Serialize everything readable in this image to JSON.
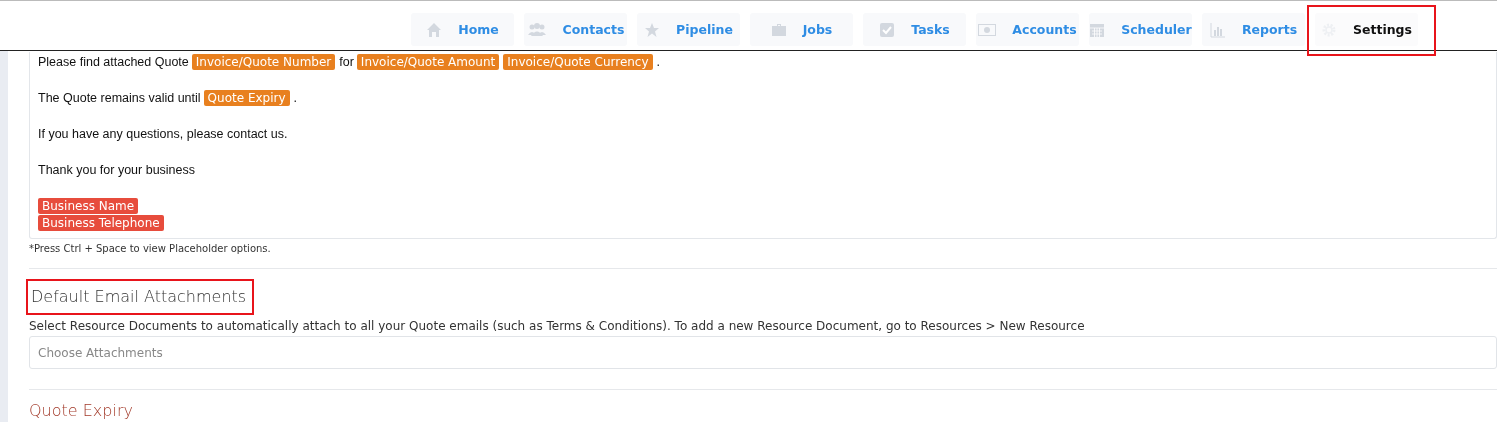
{
  "nav": {
    "tabs": [
      {
        "label": "Home",
        "selected": false,
        "highlighted": false
      },
      {
        "label": "Contacts",
        "selected": false,
        "highlighted": false
      },
      {
        "label": "Pipeline",
        "selected": false,
        "highlighted": false
      },
      {
        "label": "Jobs",
        "selected": false,
        "highlighted": false
      },
      {
        "label": "Tasks",
        "selected": false,
        "highlighted": false
      },
      {
        "label": "Accounts",
        "selected": false,
        "highlighted": false
      },
      {
        "label": "Scheduler",
        "selected": false,
        "highlighted": false
      },
      {
        "label": "Reports",
        "selected": false,
        "highlighted": false
      },
      {
        "label": "Settings",
        "selected": true,
        "highlighted": true
      }
    ]
  },
  "editor": {
    "paragraphs": [
      {
        "parts": [
          {
            "kind": "text",
            "text": "Please find attached Quote"
          },
          {
            "kind": "tag",
            "text": "Invoice/Quote Number",
            "color": "#e8801f"
          },
          {
            "kind": "text",
            "text": "for"
          },
          {
            "kind": "tag",
            "text": "Invoice/Quote Amount",
            "color": "#e8801f"
          },
          {
            "kind": "tag",
            "text": "Invoice/Quote Currency",
            "color": "#e8801f"
          },
          {
            "kind": "text",
            "text": "."
          }
        ]
      },
      {
        "parts": [
          {
            "kind": "text",
            "text": "The Quote remains valid until"
          },
          {
            "kind": "tag",
            "text": "Quote Expiry",
            "color": "#e8801f"
          },
          {
            "kind": "text",
            "text": "."
          }
        ]
      },
      {
        "parts": [
          {
            "kind": "text",
            "text": "If you have any questions, please contact us."
          }
        ]
      },
      {
        "parts": [
          {
            "kind": "text",
            "text": "Thank you for your business"
          }
        ]
      },
      {
        "parts": [
          {
            "kind": "tag",
            "text": "Business Name",
            "color": "#e74c3c"
          },
          {
            "kind": "break"
          },
          {
            "kind": "tag",
            "text": "Business Telephone",
            "color": "#e74c3c"
          }
        ]
      }
    ],
    "hint": "*Press Ctrl + Space to view Placeholder options."
  },
  "attachments": {
    "heading": "Default Email Attachments",
    "highlighted": true,
    "description": "Select Resource Documents to automatically attach to all your Quote emails (such as Terms & Conditions). To add a new Resource Document, go to Resources > New Resource",
    "placeholder": "Choose Attachments"
  },
  "next_section": {
    "heading": "Quote Expiry"
  }
}
